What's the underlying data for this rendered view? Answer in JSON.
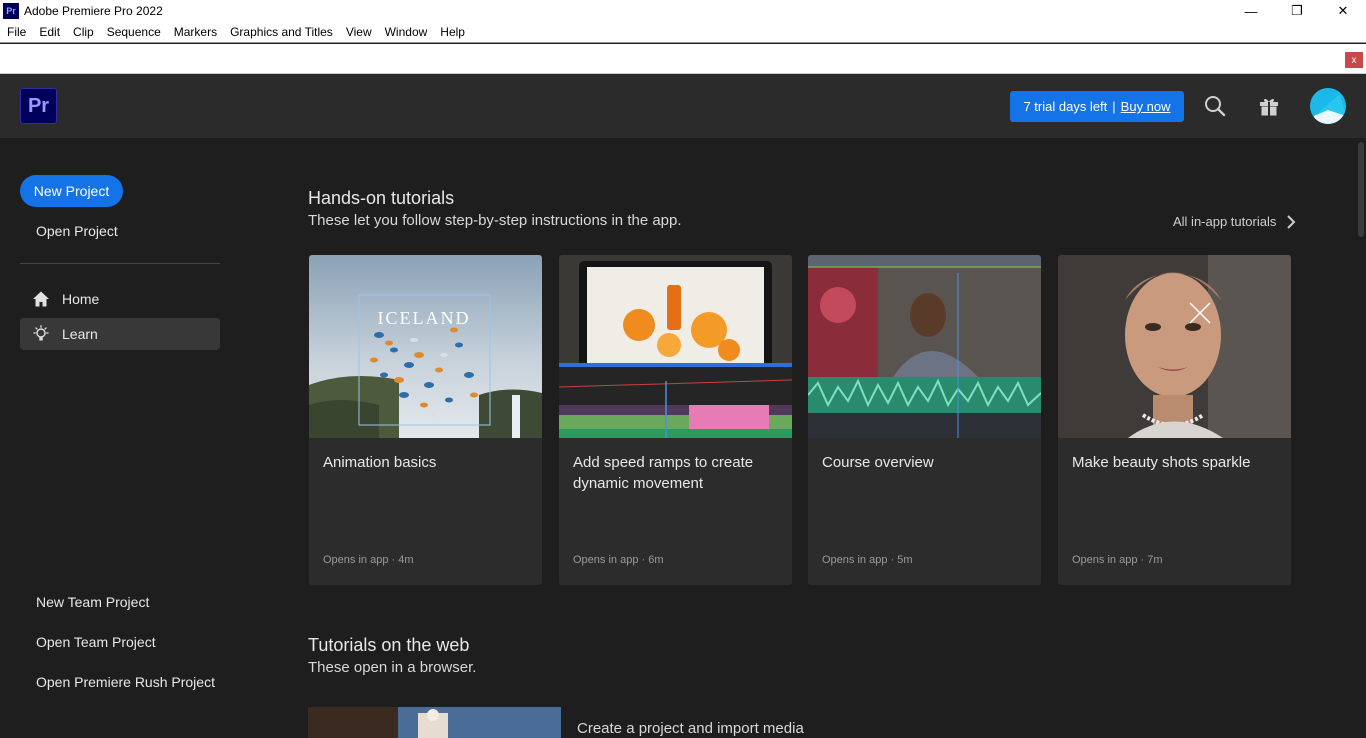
{
  "window": {
    "title": "Adobe Premiere Pro 2022",
    "app_icon_text": "Pr",
    "controls": {
      "minimize": "—",
      "maximize": "❐",
      "close": "✕"
    }
  },
  "menubar": [
    "File",
    "Edit",
    "Clip",
    "Sequence",
    "Markers",
    "Graphics and Titles",
    "View",
    "Window",
    "Help"
  ],
  "notice": {
    "close_label": "x"
  },
  "header": {
    "logo": "Pr",
    "trial_text": "7 trial days left",
    "trial_sep": "|",
    "buy_label": "Buy now",
    "icons": [
      "search-icon",
      "gift-icon",
      "avatar"
    ]
  },
  "sidebar": {
    "new_project": "New Project",
    "open_project": "Open Project",
    "nav": [
      {
        "label": "Home",
        "icon": "home-icon",
        "active": false
      },
      {
        "label": "Learn",
        "icon": "lightbulb-icon",
        "active": true
      }
    ],
    "bottom_links": [
      "New Team Project",
      "Open Team Project",
      "Open Premiere Rush Project"
    ]
  },
  "main": {
    "hands_on": {
      "title": "Hands-on tutorials",
      "subtitle": "These let you follow step-by-step instructions in the app.",
      "all_link": "All in-app tutorials"
    },
    "cards": [
      {
        "title": "Animation basics",
        "meta": "Opens in app  ·  4m",
        "thumb_text": "ICELAND"
      },
      {
        "title": "Add speed ramps to create dynamic movement",
        "meta": "Opens in app  ·  6m"
      },
      {
        "title": "Course overview",
        "meta": "Opens in app  ·  5m"
      },
      {
        "title": "Make beauty shots sparkle",
        "meta": "Opens in app  ·  7m"
      }
    ],
    "web": {
      "title": "Tutorials on the web",
      "subtitle": "These open in a browser.",
      "first_item_title": "Create a project and import media"
    }
  },
  "colors": {
    "accent": "#1473e6",
    "background": "#1e1e1e",
    "header": "#2b2b2b",
    "card": "#2c2c2c"
  }
}
